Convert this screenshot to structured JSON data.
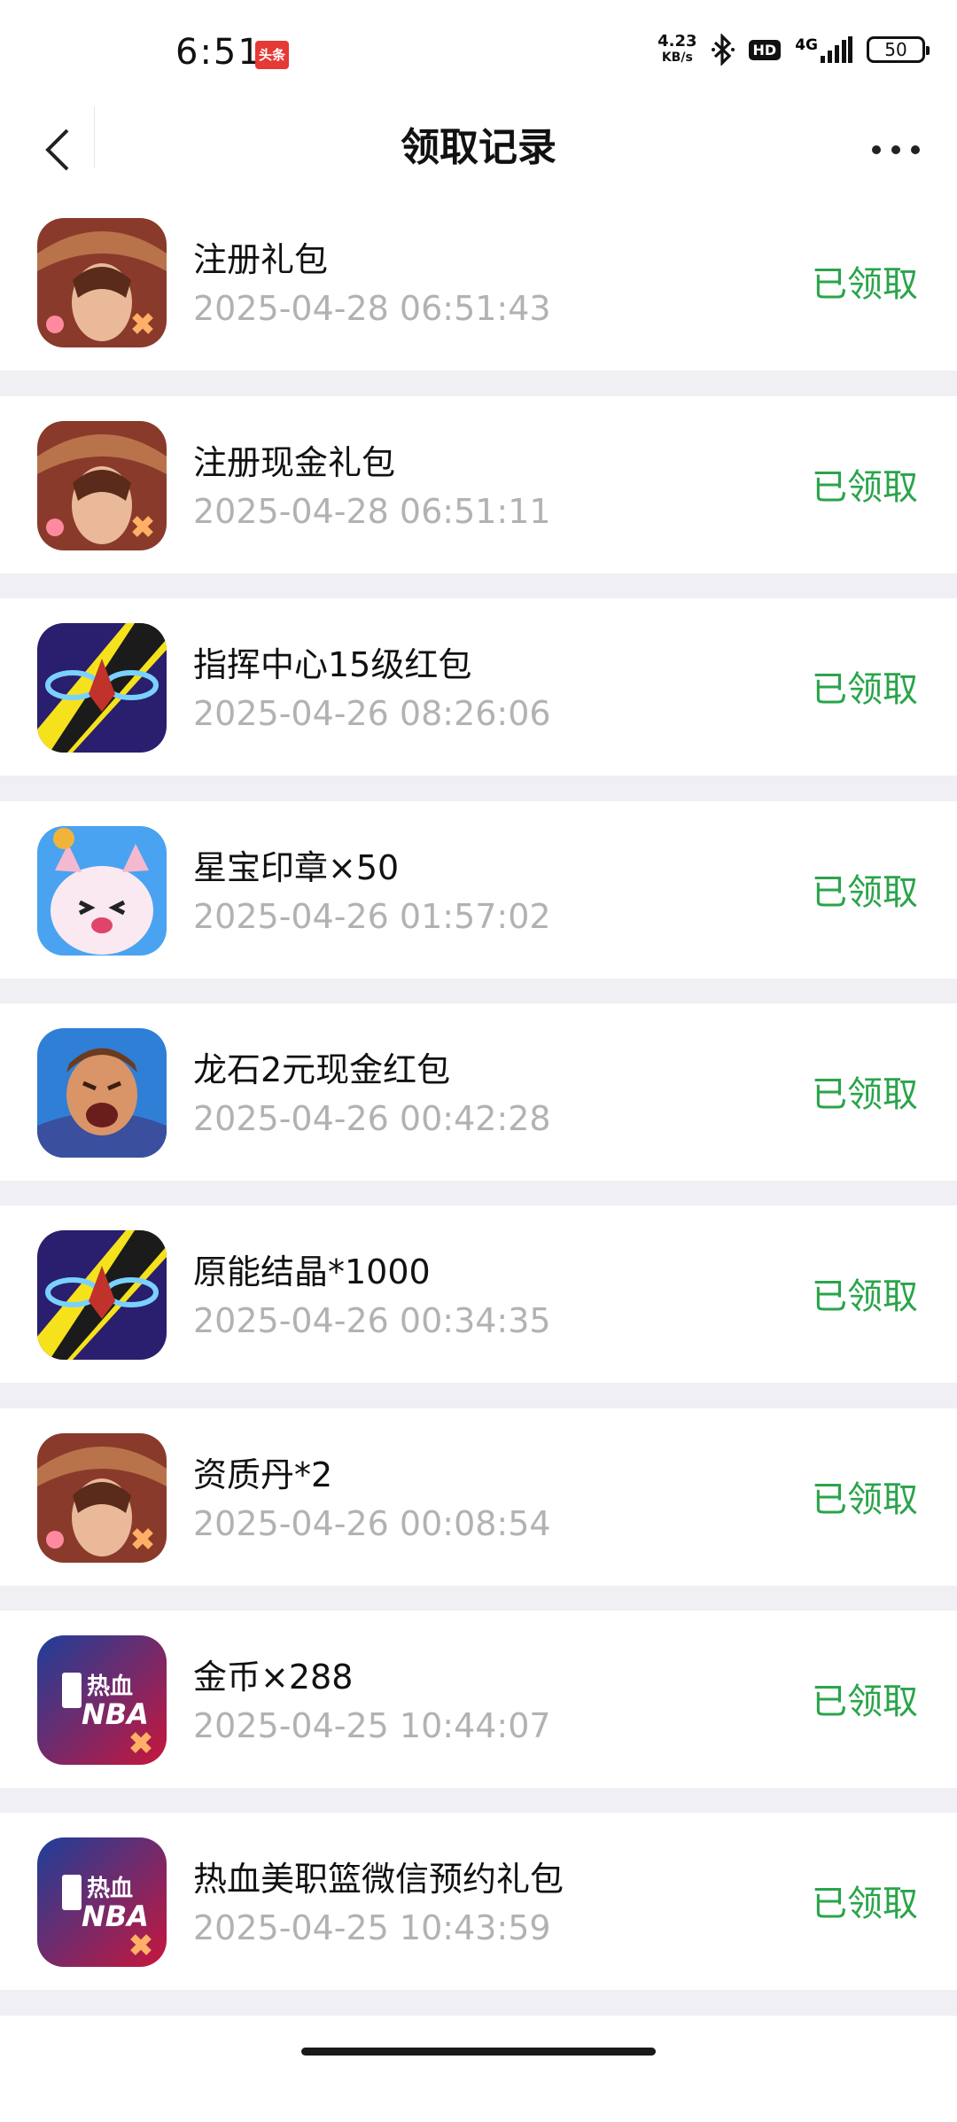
{
  "status_bar": {
    "time": "6:51",
    "badge_top": "头条",
    "badge_bottom": "",
    "net_speed_value": "4.23",
    "net_speed_unit": "KB/s",
    "hd_label": "HD",
    "signal_label": "4G",
    "battery_level": "50"
  },
  "nav": {
    "title": "领取记录"
  },
  "status_color": "#2aa44a",
  "records": [
    {
      "title": "注册礼包",
      "time": "2025-04-28 06:51:43",
      "status": "已领取",
      "icon": "warrior-game-icon"
    },
    {
      "title": "注册现金礼包",
      "time": "2025-04-28 06:51:11",
      "status": "已领取",
      "icon": "warrior-game-icon"
    },
    {
      "title": "指挥中心15级红包",
      "time": "2025-04-26 08:26:06",
      "status": "已领取",
      "icon": "spaceship-game-icon"
    },
    {
      "title": "星宝印章×50",
      "time": "2025-04-26 01:57:02",
      "status": "已领取",
      "icon": "cute-pet-game-icon"
    },
    {
      "title": "龙石2元现金红包",
      "time": "2025-04-26 00:42:28",
      "status": "已领取",
      "icon": "shouting-hero-game-icon"
    },
    {
      "title": "原能结晶*1000",
      "time": "2025-04-26 00:34:35",
      "status": "已领取",
      "icon": "spaceship-game-icon"
    },
    {
      "title": "资质丹*2",
      "time": "2025-04-26 00:08:54",
      "status": "已领取",
      "icon": "warrior-game-icon"
    },
    {
      "title": "金币×288",
      "time": "2025-04-25 10:44:07",
      "status": "已领取",
      "icon": "nba-game-icon"
    },
    {
      "title": "热血美职篮微信预约礼包",
      "time": "2025-04-25 10:43:59",
      "status": "已领取",
      "icon": "nba-game-icon"
    }
  ]
}
